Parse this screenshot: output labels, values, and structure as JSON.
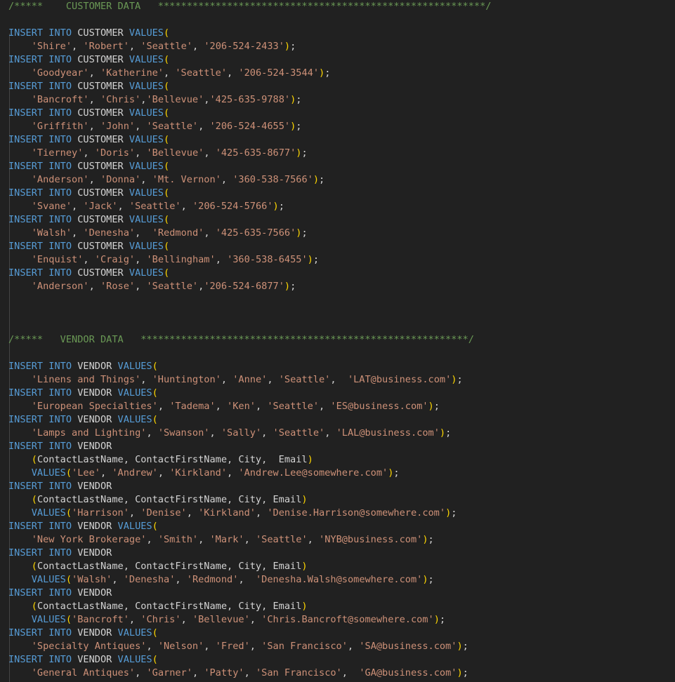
{
  "editor": {
    "background": "#212121",
    "font_size_px": 13.6,
    "line_height_px": 19,
    "language": "sql",
    "colors": {
      "keyword": "#569cd6",
      "string": "#ce9178",
      "comment": "#6a9955",
      "paren": "#ffd700",
      "identifier": "#d4d4d4",
      "indent_guide": "#4b4b4b"
    }
  },
  "sections": [
    {
      "name": "customer-data",
      "header_comment": "/*****    CUSTOMER DATA   *********************************************************/",
      "table": "CUSTOMER",
      "rows": [
        {
          "values": "'Shire', 'Robert', 'Seattle', '206-524-2433'"
        },
        {
          "values": "'Goodyear', 'Katherine', 'Seattle', '206-524-3544'"
        },
        {
          "values": "'Bancroft', 'Chris','Bellevue','425-635-9788'"
        },
        {
          "values": "'Griffith', 'John', 'Seattle', '206-524-4655'"
        },
        {
          "values": "'Tierney', 'Doris', 'Bellevue', '425-635-8677'"
        },
        {
          "values": "'Anderson', 'Donna', 'Mt. Vernon', '360-538-7566'"
        },
        {
          "values": "'Svane', 'Jack', 'Seattle', '206-524-5766'"
        },
        {
          "values": "'Walsh', 'Denesha',  'Redmond', '425-635-7566'"
        },
        {
          "values": "'Enquist', 'Craig', 'Bellingham', '360-538-6455'"
        },
        {
          "values": "'Anderson', 'Rose', 'Seattle','206-524-6877'"
        }
      ]
    },
    {
      "name": "vendor-data",
      "header_comment": "/*****   VENDOR DATA   *********************************************************/",
      "table": "VENDOR",
      "column_list": "(ContactLastName, ContactFirstName, City, Email)",
      "column_list_wide": "(ContactLastName, ContactFirstName, City,  Email)",
      "rows": [
        {
          "form": "values",
          "values": "'Linens and Things', 'Huntington', 'Anne', 'Seattle',  'LAT@business.com'"
        },
        {
          "form": "values",
          "values": "'European Specialties', 'Tadema', 'Ken', 'Seattle', 'ES@business.com'"
        },
        {
          "form": "values",
          "values": "'Lamps and Lighting', 'Swanson', 'Sally', 'Seattle', 'LAL@business.com'"
        },
        {
          "form": "columns",
          "columns": "(ContactLastName, ContactFirstName, City,  Email)",
          "values": "'Lee', 'Andrew', 'Kirkland', 'Andrew.Lee@somewhere.com'"
        },
        {
          "form": "columns",
          "columns": "(ContactLastName, ContactFirstName, City, Email)",
          "values": "'Harrison', 'Denise', 'Kirkland', 'Denise.Harrison@somewhere.com'"
        },
        {
          "form": "values",
          "values": "'New York Brokerage', 'Smith', 'Mark', 'Seattle', 'NYB@business.com'"
        },
        {
          "form": "columns",
          "columns": "(ContactLastName, ContactFirstName, City, Email)",
          "values": "'Walsh', 'Denesha', 'Redmond',  'Denesha.Walsh@somewhere.com'"
        },
        {
          "form": "columns",
          "columns": "(ContactLastName, ContactFirstName, City, Email)",
          "values": "'Bancroft', 'Chris', 'Bellevue', 'Chris.Bancroft@somewhere.com'"
        },
        {
          "form": "values",
          "values": "'Specialty Antiques', 'Nelson', 'Fred', 'San Francisco', 'SA@business.com'"
        },
        {
          "form": "values",
          "values": "'General Antiques', 'Garner', 'Patty', 'San Francisco',  'GA@business.com'"
        }
      ]
    }
  ],
  "tokens": {
    "insert_into": "INSERT INTO",
    "values": "VALUES",
    "open_paren": "(",
    "close_paren": ")",
    "semicolon": ";",
    "indent": "    "
  }
}
